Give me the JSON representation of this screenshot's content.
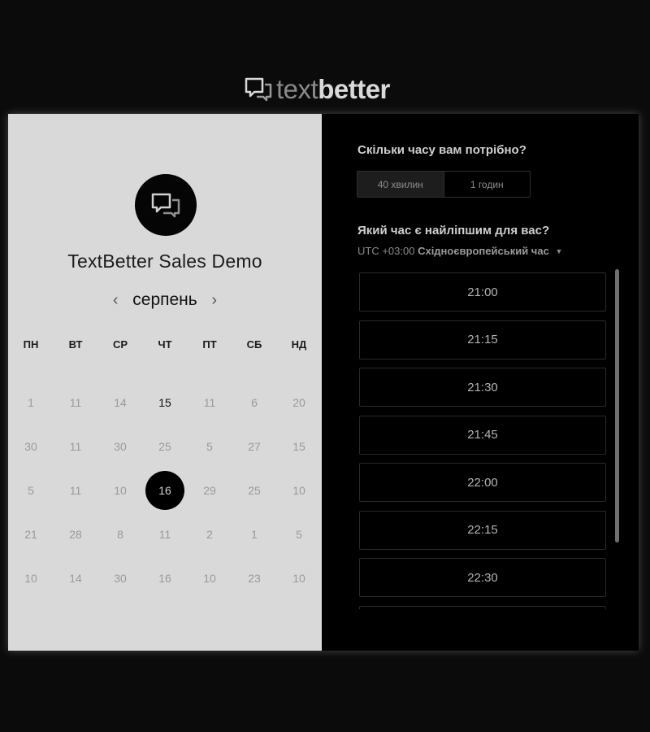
{
  "logo": {
    "text_light": "text",
    "text_bold": "better"
  },
  "event": {
    "title": "TextBetter Sales Demo"
  },
  "calendar": {
    "month": "серпень",
    "weekdays": [
      "ПН",
      "ВТ",
      "СР",
      "ЧТ",
      "ПТ",
      "СБ",
      "НД"
    ],
    "weeks": [
      [
        "1",
        "11",
        "14",
        "15",
        "11",
        "6",
        "20"
      ],
      [
        "30",
        "11",
        "30",
        "25",
        "5",
        "27",
        "15"
      ],
      [
        "5",
        "11",
        "10",
        "16",
        "29",
        "25",
        "10"
      ],
      [
        "21",
        "28",
        "8",
        "11",
        "2",
        "1",
        "5"
      ],
      [
        "10",
        "14",
        "30",
        "16",
        "10",
        "23",
        "10"
      ]
    ],
    "selected_day": "16",
    "emphasized_day": "15"
  },
  "duration": {
    "question": "Скільки часу вам потрібно?",
    "options": [
      "40 хвилин",
      "1 годин"
    ],
    "selected": "40 хвилин"
  },
  "time": {
    "question": "Який час є найліпшим для вас?",
    "tz_offset": "UTC +03:00",
    "tz_name": "Східноєвропейський час",
    "slots": [
      "21:00",
      "21:15",
      "21:30",
      "21:45",
      "22:00",
      "22:15",
      "22:30"
    ]
  }
}
